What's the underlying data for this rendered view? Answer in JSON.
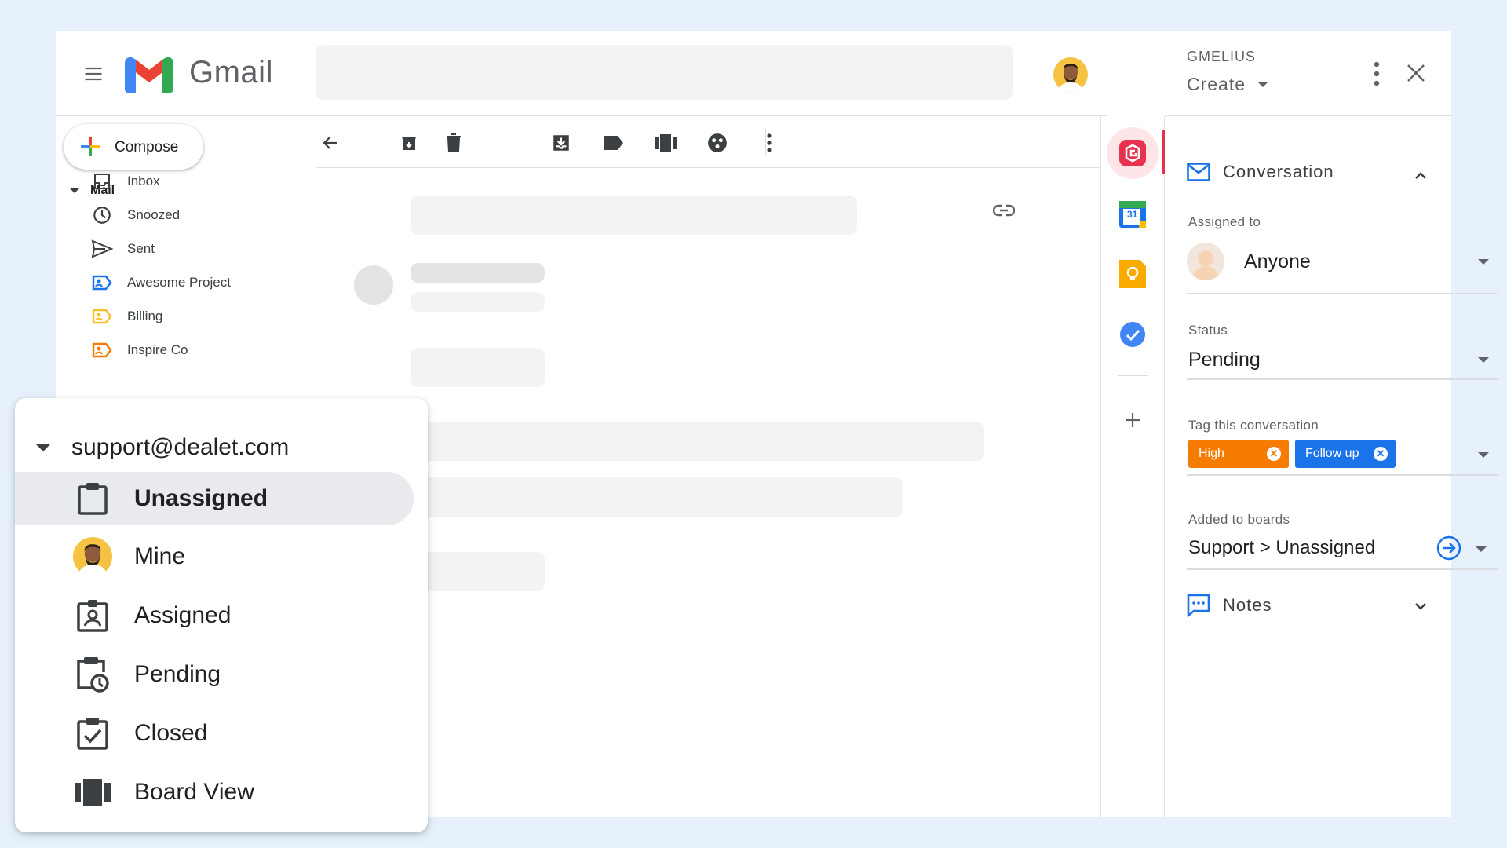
{
  "app": {
    "name": "Gmail"
  },
  "compose": {
    "label": "Compose"
  },
  "nav": {
    "section_label": "Mail",
    "items": [
      {
        "label": "Inbox",
        "icon": "inbox-icon"
      },
      {
        "label": "Snoozed",
        "icon": "clock-icon"
      },
      {
        "label": "Sent",
        "icon": "send-icon"
      },
      {
        "label": "Awesome Project",
        "icon": "label-icon",
        "color": "#1a73e8"
      },
      {
        "label": "Billing",
        "icon": "label-icon",
        "color": "#f9bf2d"
      },
      {
        "label": "Inspire Co",
        "icon": "label-icon",
        "color": "#f57c00"
      }
    ]
  },
  "popup": {
    "account": "support@dealet.com",
    "items": [
      {
        "label": "Unassigned",
        "icon": "clipboard-icon",
        "selected": true
      },
      {
        "label": "Mine",
        "icon": "avatar"
      },
      {
        "label": "Assigned",
        "icon": "assigned-badge-icon"
      },
      {
        "label": "Pending",
        "icon": "clipboard-clock-icon"
      },
      {
        "label": "Closed",
        "icon": "clipboard-check-icon"
      },
      {
        "label": "Board View",
        "icon": "board-icon"
      }
    ]
  },
  "toolbar": {
    "icons": [
      "back-arrow-icon",
      "archive-icon",
      "delete-icon",
      "move-to-inbox-icon",
      "label-icon",
      "board-icon",
      "share-icon",
      "more-vert-icon"
    ]
  },
  "rail": {
    "icons": [
      "gmelius-icon",
      "calendar-icon",
      "keep-icon",
      "tasks-icon",
      "add-icon"
    ],
    "calendar_day": "31"
  },
  "gmelius": {
    "brand": "GMELIUS",
    "create_label": "Create",
    "conversation": {
      "title": "Conversation",
      "assigned_to_label": "Assigned to",
      "assigned_to_value": "Anyone",
      "status_label": "Status",
      "status_value": "Pending",
      "tags_label": "Tag this conversation",
      "tags": [
        {
          "label": "High",
          "color": "#f57c00"
        },
        {
          "label": "Follow up",
          "color": "#1a73e8"
        }
      ],
      "boards_label": "Added to boards",
      "boards_value": "Support > Unassigned"
    },
    "notes": {
      "title": "Notes"
    }
  },
  "colors": {
    "background": "#e7f1fb",
    "gmelius_red": "#e8304f",
    "accent_blue": "#1a73e8"
  }
}
